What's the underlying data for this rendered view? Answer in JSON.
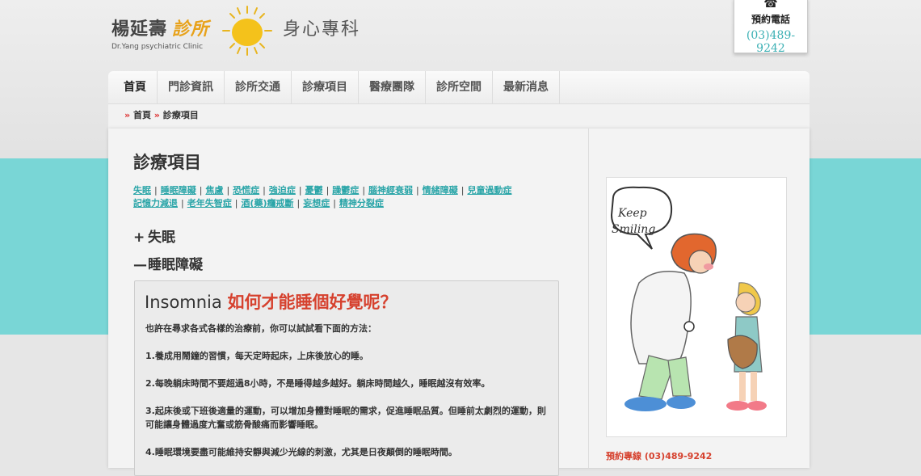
{
  "header": {
    "name": "楊延壽",
    "clinic": "診所",
    "sub": "Dr.Yang psychiatric Clinic",
    "dept": "身心專科",
    "phone_label": "預約電話",
    "phone_number": "(03)489-9242"
  },
  "nav": {
    "items": [
      "首頁",
      "門診資訊",
      "診所交通",
      "診療項目",
      "醫療團隊",
      "診所空間",
      "最新消息"
    ]
  },
  "breadcrumb": {
    "home": "首頁",
    "current": "診療項目"
  },
  "main": {
    "title": "診療項目",
    "links": [
      "失眠",
      "睡眠障礙",
      "焦慮",
      "恐慌症",
      "強迫症",
      "憂鬱",
      "躁鬱症",
      "腦神經衰弱",
      "情緒障礙",
      "兒童過動症",
      "記憶力減退",
      "老年失智症",
      "酒(藥)癮戒斷",
      "妄想症",
      "精神分裂症"
    ],
    "accordion": [
      {
        "symbol": "+",
        "label": "失眠"
      },
      {
        "symbol": "—",
        "label": "睡眠障礙"
      }
    ],
    "box_title_en": "Insomnia",
    "box_title_zh": "如何才能睡個好覺呢？",
    "paragraphs": [
      "也許在尋求各式各樣的治療前，你可以試試看下面的方法：",
      "1.養成用鬧鐘的習慣，每天定時起床，上床後放心的睡。",
      "2.每晚躺床時間不要超過8小時，不是睡得越多越好。躺床時間越久，睡眠越沒有效率。",
      "3.起床後或下班後適量的運動，可以增加身體對睡眠的需求，促進睡眠品質。但睡前太劇烈的運動，則可能讓身體過度亢奮或筋骨酸痛而影響睡眠。",
      "4.睡眠環境要盡可能維持安靜與減少光線的刺激，尤其是日夜顛倒的睡眠時間。"
    ]
  },
  "sidebar": {
    "bubble_line1": "Keep",
    "bubble_line2": "Smiling",
    "phone": "預約專線 (03)489-9242"
  }
}
